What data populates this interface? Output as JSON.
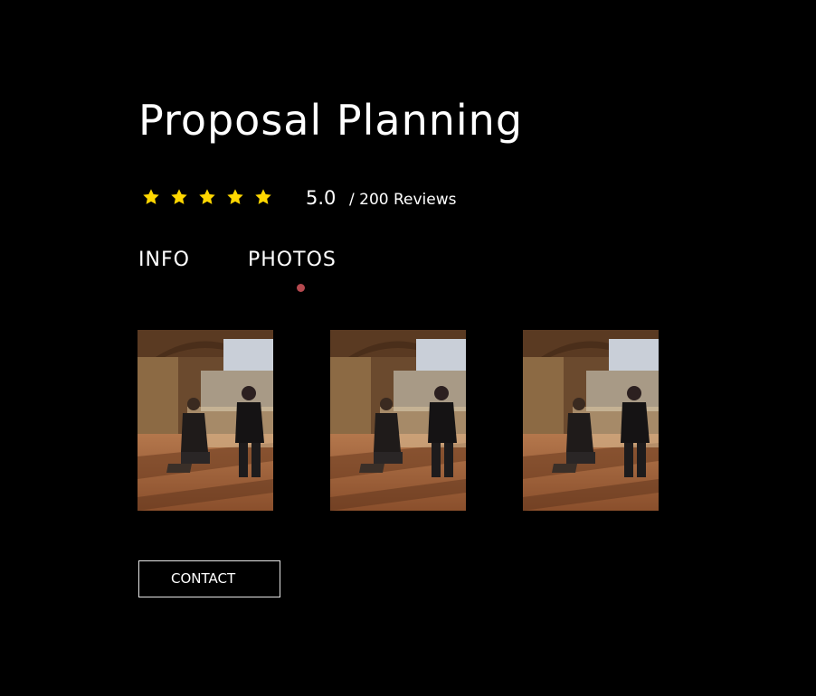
{
  "page": {
    "title": "Proposal Planning"
  },
  "rating": {
    "stars": 5,
    "max_stars": 5,
    "value": "5.0",
    "reviews": "/ 200 Reviews",
    "star_color": "#ffd700"
  },
  "tabs": [
    {
      "label": "INFO",
      "active": false
    },
    {
      "label": "PHOTOS",
      "active": true
    }
  ],
  "tab_indicator_color": "#b5494f",
  "gallery": {
    "photos": [
      {
        "subject": "proposal photo"
      },
      {
        "subject": "proposal photo"
      },
      {
        "subject": "proposal photo"
      }
    ]
  },
  "contact": {
    "label": "CONTACT"
  }
}
